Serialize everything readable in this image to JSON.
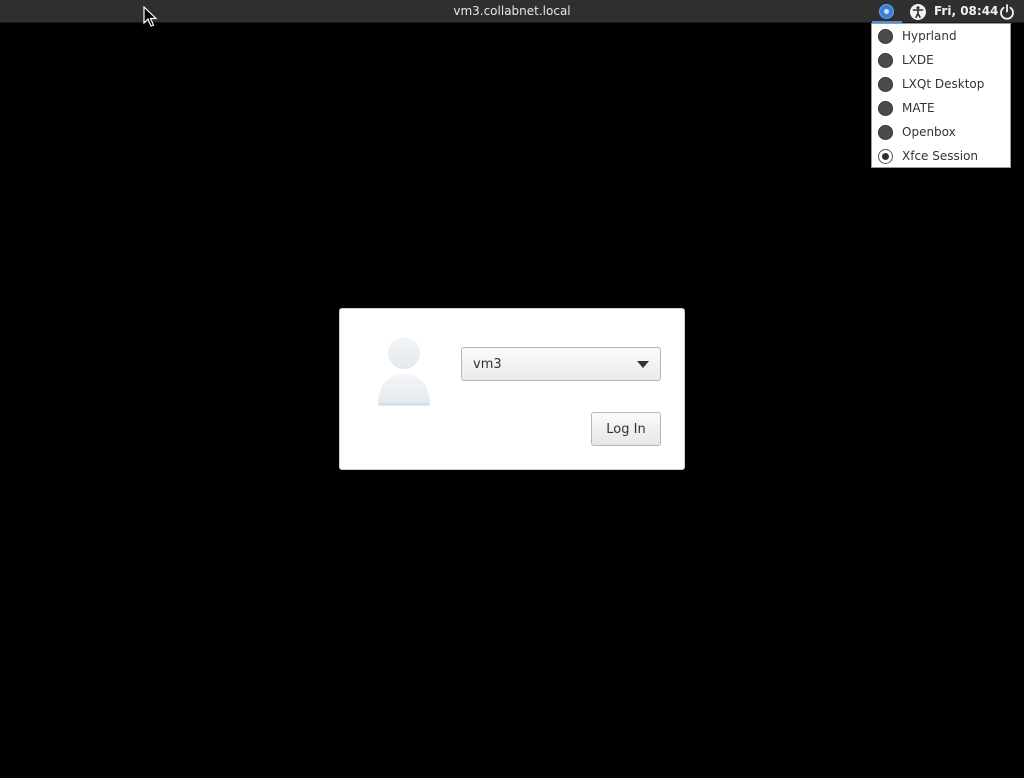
{
  "top_panel": {
    "hostname": "vm3.collabnet.local",
    "clock": "Fri, 08:44",
    "icons": [
      "session-indicator-icon",
      "accessibility-icon",
      "power-icon"
    ]
  },
  "session_menu": {
    "items": [
      {
        "label": "Hyprland",
        "checked": false
      },
      {
        "label": "LXDE",
        "checked": false
      },
      {
        "label": "LXQt Desktop",
        "checked": false
      },
      {
        "label": "MATE",
        "checked": false
      },
      {
        "label": "Openbox",
        "checked": false
      },
      {
        "label": "Xfce Session",
        "checked": true
      }
    ]
  },
  "login": {
    "selected_user": "vm3",
    "login_label": "Log In"
  },
  "colors": {
    "background": "#000000",
    "panel": "#2f2f2f",
    "accent": "#3a7fd5"
  }
}
